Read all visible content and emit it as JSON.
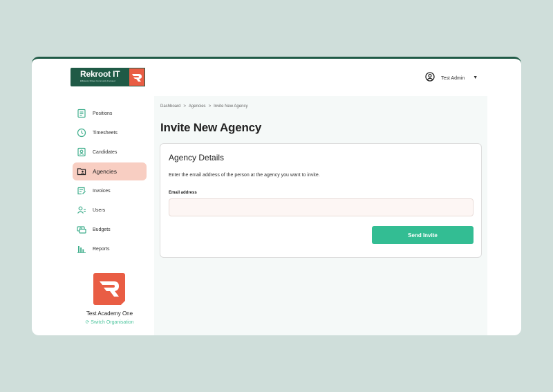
{
  "brand": {
    "name": "Rekroot IT",
    "tagline": "Efficiency Driven Community Focused"
  },
  "user_menu": {
    "label": "Test Admin"
  },
  "sidebar": {
    "items": [
      {
        "label": "Positions",
        "icon": "positions-icon",
        "active": false
      },
      {
        "label": "Timesheets",
        "icon": "timesheets-icon",
        "active": false
      },
      {
        "label": "Candidates",
        "icon": "candidates-icon",
        "active": false
      },
      {
        "label": "Agencies",
        "icon": "agencies-icon",
        "active": true
      },
      {
        "label": "Invoices",
        "icon": "invoices-icon",
        "active": false
      },
      {
        "label": "Users",
        "icon": "users-icon",
        "active": false
      },
      {
        "label": "Budgets",
        "icon": "budgets-icon",
        "active": false
      },
      {
        "label": "Reports",
        "icon": "reports-icon",
        "active": false
      }
    ],
    "org_name": "Test Academy One",
    "switch_label": "Switch Organisation"
  },
  "breadcrumb": {
    "items": [
      "Dashboard",
      "Agencies",
      "Invite New Agency"
    ],
    "separator": ">"
  },
  "page": {
    "title": "Invite New Agency"
  },
  "card": {
    "title": "Agency Details",
    "description": "Enter the email address of the person at the agency you want to invite.",
    "email_label": "Email address",
    "email_value": "",
    "email_placeholder": "",
    "submit_label": "Send Invite"
  },
  "colors": {
    "background": "#cfdeda",
    "brand_green": "#1f5a46",
    "brand_orange": "#e95d44",
    "accent_green": "#33bd93",
    "active_nav_bg": "#f8cec2",
    "icon_green": "#3fae8c"
  }
}
